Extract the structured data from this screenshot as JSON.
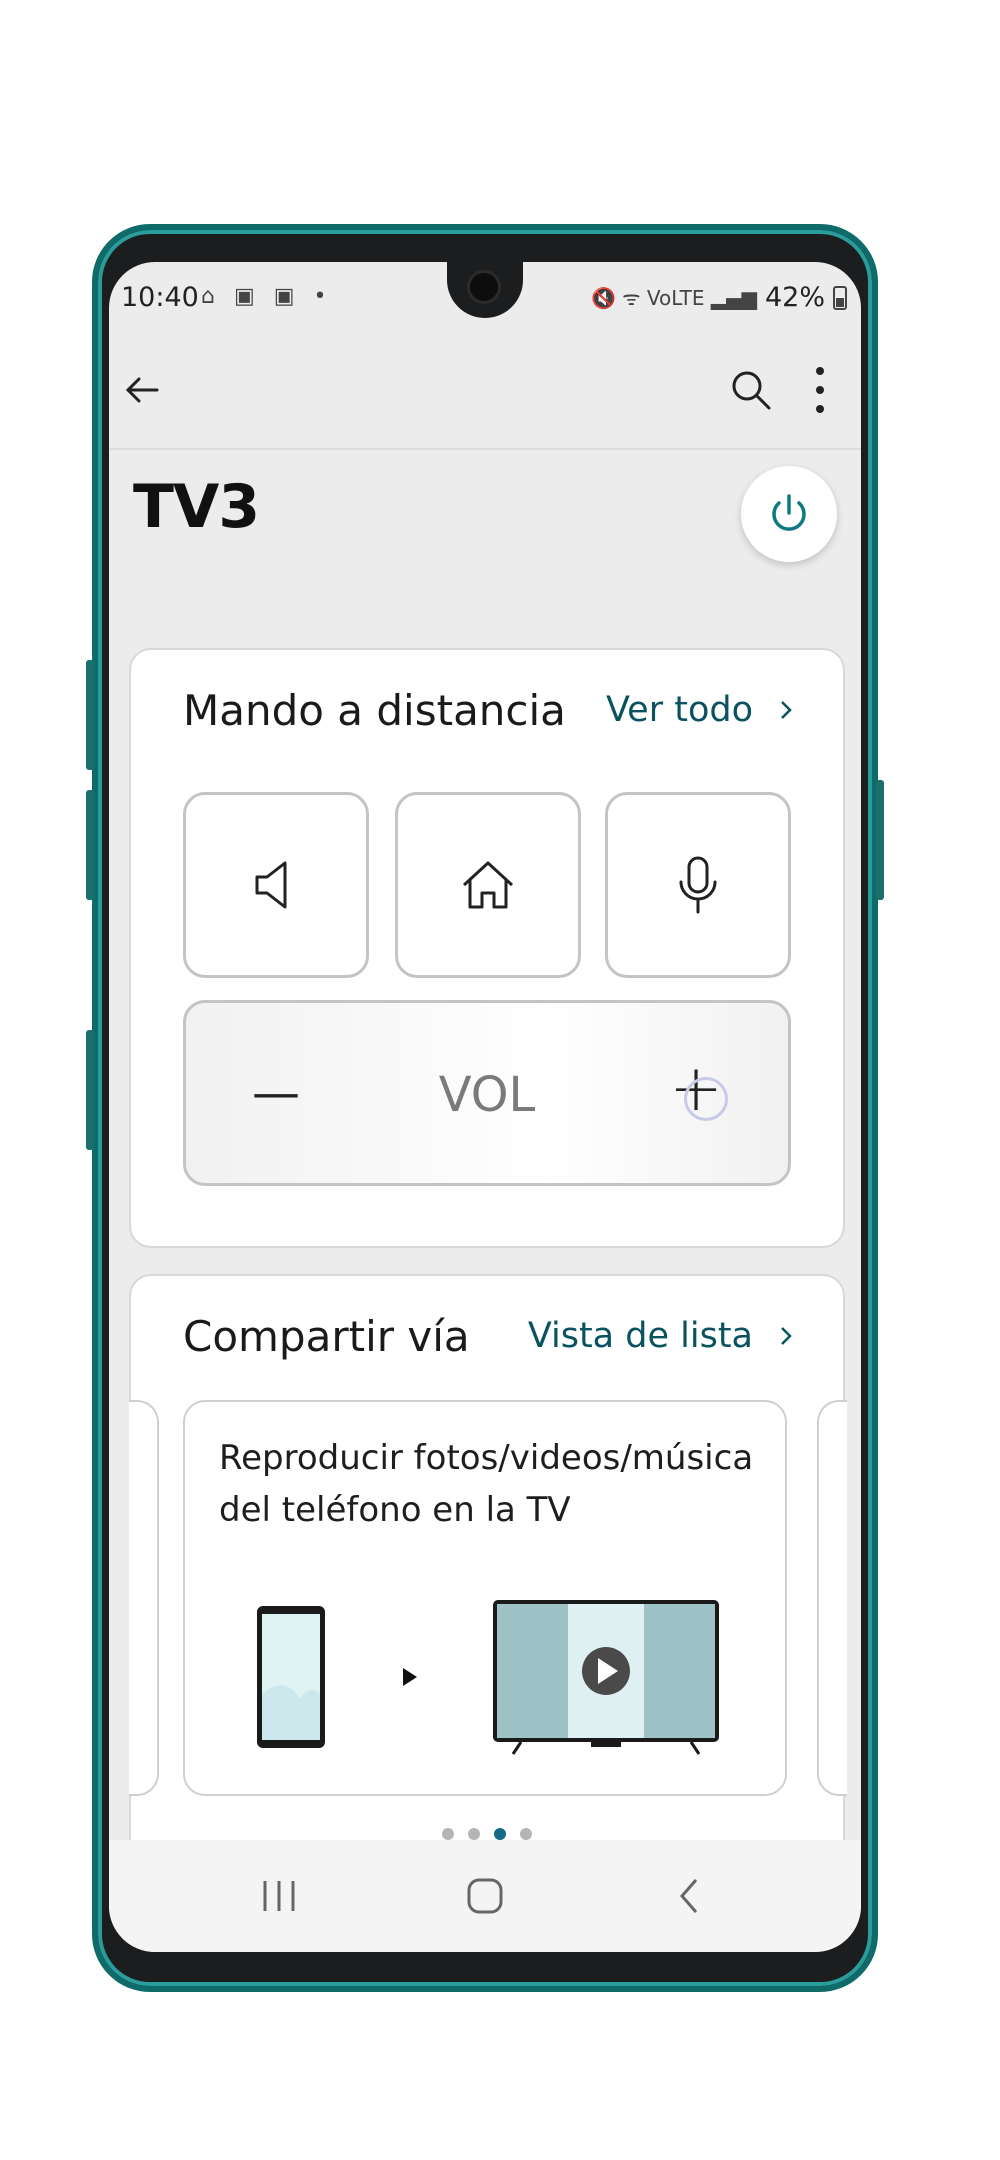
{
  "status_bar": {
    "time": "10:40",
    "left_icons": "⌂ ▣ ▣ •",
    "right_icons": "🔇 ᯤ VoLTE ▂▄▆",
    "battery": "42%"
  },
  "app_bar": {
    "back_icon": "back-arrow-icon",
    "search_icon": "search-icon",
    "more_icon": "more-vertical-icon"
  },
  "page": {
    "title": "TV3",
    "power_icon": "power-icon"
  },
  "remote_card": {
    "title": "Mando a distancia",
    "link": "Ver todo",
    "buttons": [
      {
        "icon": "speaker-icon"
      },
      {
        "icon": "home-icon"
      },
      {
        "icon": "microphone-icon"
      }
    ],
    "volume": {
      "label": "VOL",
      "minus": "—",
      "plus": "+"
    }
  },
  "share_card": {
    "title": "Compartir vía",
    "link": "Vista de lista",
    "panel_text": "Reproducir fotos/videos/música del teléfono en la TV",
    "page_dots": 4,
    "active_dot": 3
  },
  "nav_bar": {
    "recents_icon": "recent-apps-icon",
    "home_icon": "home-circle-icon",
    "back_icon": "back-chevron-icon"
  },
  "colors": {
    "accent": "#0a5260",
    "active_dot": "#156b86",
    "frame": "#0e6b6a"
  }
}
